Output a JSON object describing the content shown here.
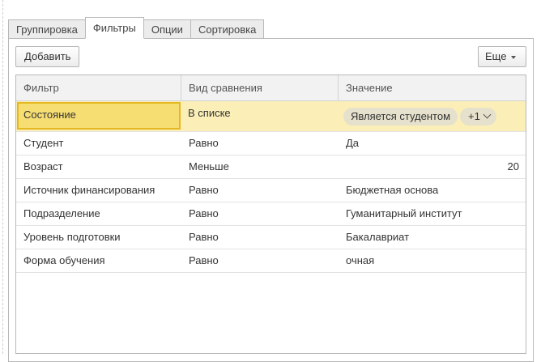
{
  "tabs": [
    {
      "label": "Группировка",
      "active": false
    },
    {
      "label": "Фильтры",
      "active": true
    },
    {
      "label": "Опции",
      "active": false
    },
    {
      "label": "Сортировка",
      "active": false
    }
  ],
  "toolbar": {
    "add_label": "Добавить",
    "more_label": "Еще"
  },
  "table": {
    "columns": [
      "Фильтр",
      "Вид сравнения",
      "Значение"
    ],
    "rows": [
      {
        "filter": "Состояние",
        "comparison": "В списке",
        "value": "Является студентом",
        "extra": "+1",
        "selected": true
      },
      {
        "filter": "Студент",
        "comparison": "Равно",
        "value": "Да"
      },
      {
        "filter": "Возраст",
        "comparison": "Меньше",
        "value": "20"
      },
      {
        "filter": "Источник финансирования",
        "comparison": "Равно",
        "value": "Бюджетная основа"
      },
      {
        "filter": "Подразделение",
        "comparison": "Равно",
        "value": "Гуманитарный институт"
      },
      {
        "filter": "Уровень подготовки",
        "comparison": "Равно",
        "value": "Бакалавриат"
      },
      {
        "filter": "Форма обучения",
        "comparison": "Равно",
        "value": "очная"
      }
    ]
  },
  "colors": {
    "selected_row": "#fbefb7",
    "selected_cell": "#f7de73",
    "selected_border": "#e5b822",
    "chip": "#e5e1cc"
  }
}
